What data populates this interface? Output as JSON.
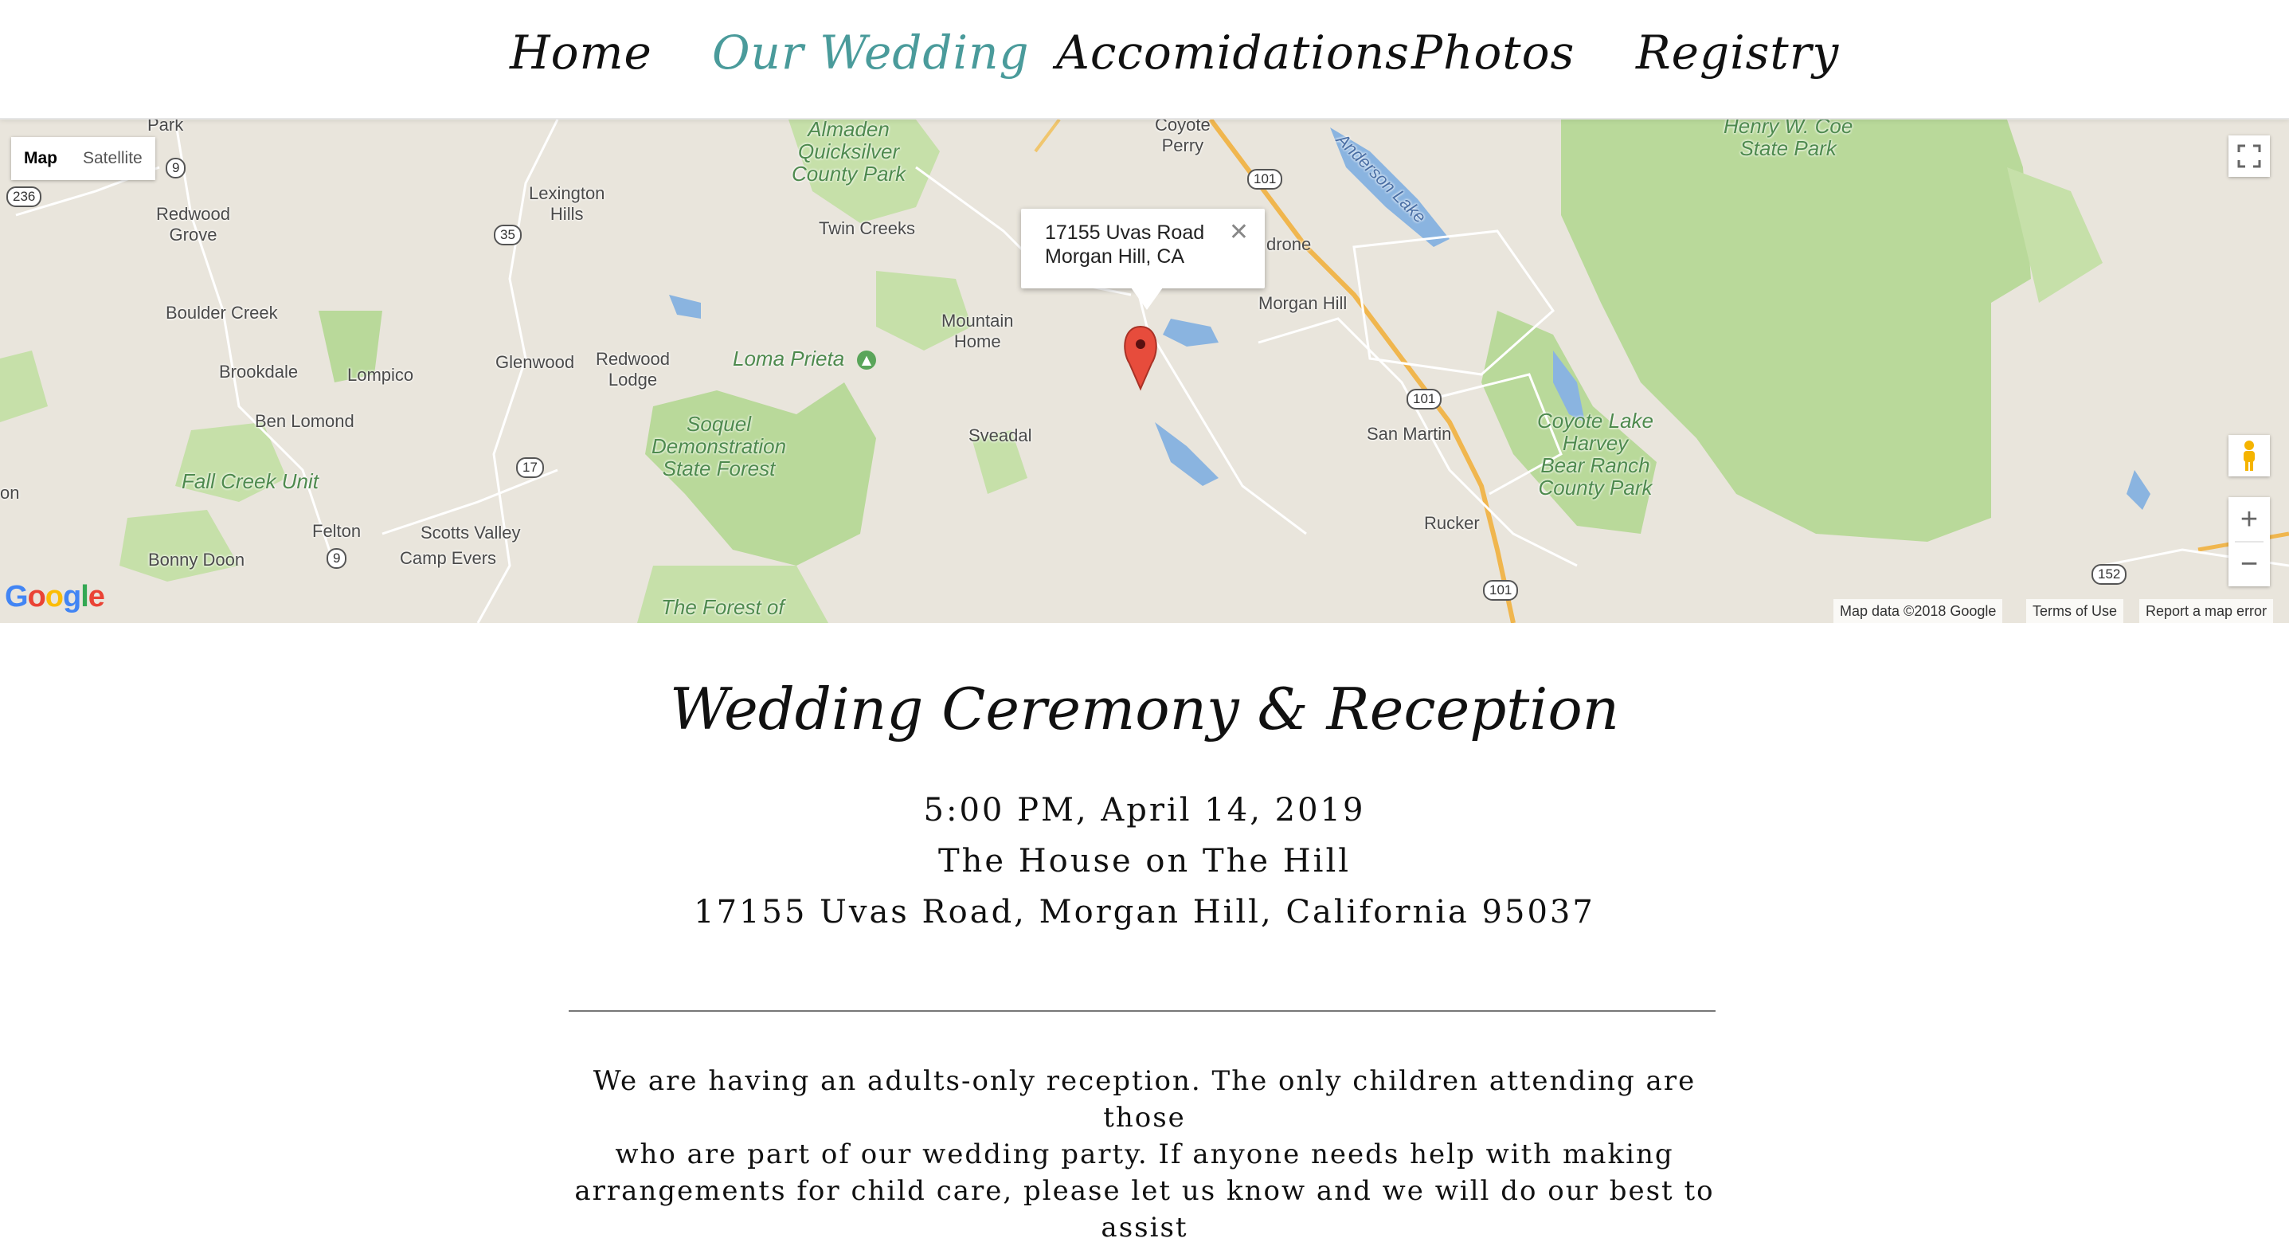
{
  "nav": {
    "items": [
      {
        "label": "Home",
        "active": false
      },
      {
        "label": "Our Wedding",
        "active": true
      },
      {
        "label": "Accomidations",
        "active": false
      },
      {
        "label": "Photos",
        "active": false
      },
      {
        "label": "Registry",
        "active": false
      }
    ],
    "active_color": "#4a9b9b"
  },
  "map": {
    "type_controls": {
      "map": "Map",
      "satellite": "Satellite",
      "selected": "Map"
    },
    "info_window": {
      "line1": "17155 Uvas Road",
      "line2": "Morgan Hill, CA",
      "close": "✕"
    },
    "places": {
      "park_top": "Park",
      "redwood_grove": "Redwood\nGrove",
      "boulder_creek": "Boulder Creek",
      "brookdale": "Brookdale",
      "lompico": "Lompico",
      "ben_lomond": "Ben Lomond",
      "felton": "Felton",
      "bonny_doon": "Bonny Doon",
      "scotts_valley": "Scotts Valley",
      "camp_evers": "Camp Evers",
      "lexington_hills": "Lexington\nHills",
      "glenwood": "Glenwood",
      "redwood_lodge": "Redwood\nLodge",
      "twin_creeks": "Twin Creeks",
      "mountain_home": "Mountain\nHome",
      "sveadal": "Sveadal",
      "coyote_perry": "Coyote\nPerry",
      "drone": "drone",
      "morgan_hill": "Morgan Hill",
      "san_martin": "San Martin",
      "rucker": "Rucker",
      "edge_on": "on"
    },
    "parks": {
      "almaden": "Almaden\nQuicksilver\nCounty Park",
      "henry_coe": "Henry W. Coe\nState Park",
      "loma_prieta": "Loma Prieta",
      "soquel": "Soquel\nDemonstration\nState Forest",
      "fall_creek": "Fall Creek Unit",
      "coyote_lake": "Coyote Lake\nHarvey\nBear Ranch\nCounty Park",
      "forest_of": "The Forest of",
      "anderson_lake": "Anderson Lake"
    },
    "shields": {
      "s236": "236",
      "s9a": "9",
      "s35": "35",
      "s17": "17",
      "s9b": "9",
      "s101a": "101",
      "s101b": "101",
      "s101c": "101",
      "s152": "152"
    },
    "zoom_in": "+",
    "zoom_out": "−",
    "logo": "Google",
    "attribution": {
      "data": "Map data ©2018 Google",
      "terms": "Terms of Use",
      "report": "Report a map error"
    }
  },
  "event": {
    "title": "Wedding Ceremony & Reception",
    "time": "5:00 PM, April 14, 2019",
    "venue": "The House on The Hill",
    "address": "17155 Uvas Road, Morgan Hill, California 95037"
  },
  "notice": {
    "line1": "We are having an adults-only reception. The only children attending are those",
    "line2": "who are part of our wedding party. If anyone needs help with making",
    "line3": "arrangements for child care, please let us know and we will do our best to assist"
  }
}
